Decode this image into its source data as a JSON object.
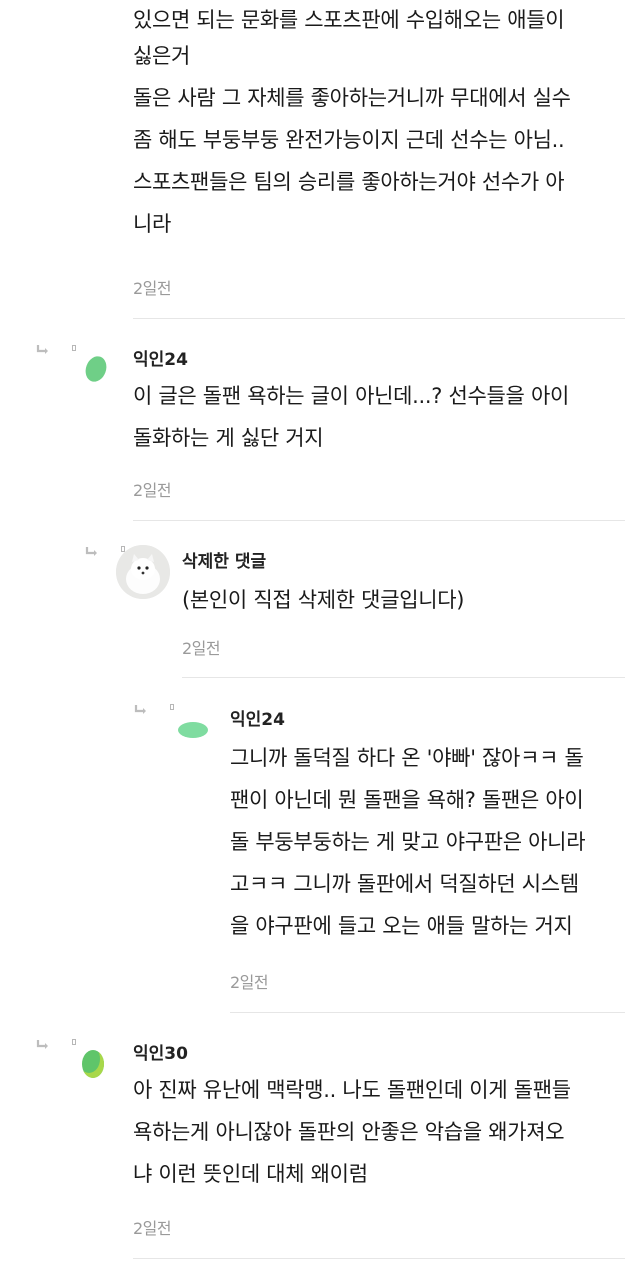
{
  "thread": {
    "top_comment": {
      "lines": [
        "있으면 되는 문화를 스포츠판에 수입해오는 애들이",
        "싫은거",
        "돌은 사람 그 자체를 좋아하는거니까 무대에서 실수",
        "좀 해도 부둥부둥 완전가능이지 근데 선수는 아님..",
        "스포츠팬들은 팀의 승리를 좋아하는거야 선수가 아",
        "니라"
      ],
      "time": "2일전"
    },
    "comments": [
      {
        "author": "익인24",
        "lines": [
          "이 글은 돌팬 욕하는 글이 아닌데...? 선수들을 아이",
          "돌화하는 게 싫단 거지"
        ],
        "time": "2일전",
        "avatar_color": "#6fcf87"
      },
      {
        "author": "삭제한 댓글",
        "lines": [
          "(본인이 직접 삭제한 댓글입니다)"
        ],
        "time": "2일전",
        "avatar_color": "#e9e9e9"
      },
      {
        "author": "익인24",
        "lines": [
          "그니까 돌덕질 하다 온 '야빠' 잖아ㅋㅋ 돌",
          "팬이 아닌데 뭔 돌팬을 욕해? 돌팬은 아이",
          "돌 부둥부둥하는 게 맞고 야구판은 아니라",
          "고ㅋㅋ 그니까 돌판에서 덕질하던 시스템",
          "을 야구판에 들고 오는 애들 말하는 거지"
        ],
        "time": "2일전",
        "avatar_color": "#7fdca0"
      },
      {
        "author": "익인30",
        "lines": [
          "아 진짜 유난에 맥락맹.. 나도 돌팬인데 이게 돌팬들",
          "욕하는게 아니잖아 돌판의 안좋은 악습을 왜가져오",
          "냐 이런 뜻인데 대체 왜이럼"
        ],
        "time": "2일전",
        "avatar_color": "#5fc56a"
      }
    ]
  }
}
